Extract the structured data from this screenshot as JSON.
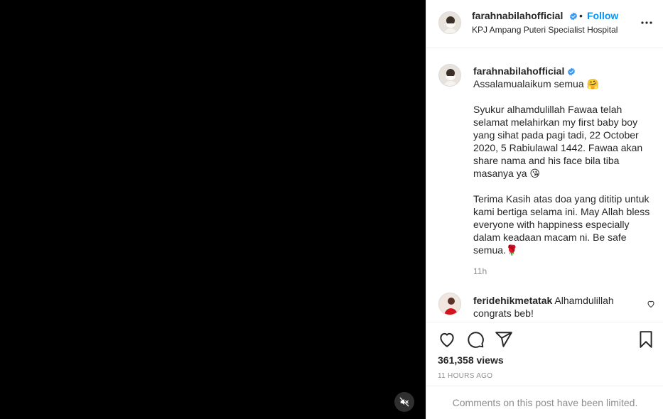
{
  "post": {
    "username": "farahnabilahofficial",
    "follow_label": "Follow",
    "separator": "•",
    "location": "KPJ Ampang Puteri Specialist Hospital",
    "caption": {
      "paragraphs": [
        "Assalamualaikum semua 🤗",
        "Syukur alhamdulillah Fawaa telah selamat melahirkan my first baby boy yang sihat pada pagi tadi, 22 October 2020, 5 Rabiulawal 1442. Fawaa akan share nama and his face bila tiba masanya ya 😘",
        "Terima Kasih atas doa yang dititip untuk kami bertiga selama ini. May Allah bless everyone with happiness especially dalam keadaan macam ni. Be safe semua.🌹"
      ],
      "time_ago": "11h"
    },
    "comment": {
      "username": "feridehikmetatak",
      "text": "Alhamdulillah congrats beb!"
    },
    "views_count": "361,358",
    "views_label": "views",
    "date": "11 HOURS AGO",
    "comments_limited": "Comments on this post have been limited."
  },
  "icons": {
    "verified": "verified-badge-icon",
    "more": "more-options-icon",
    "like": "heart-icon",
    "comment": "comment-icon",
    "share": "share-icon",
    "save": "bookmark-icon",
    "mute": "muted-speaker-icon"
  },
  "colors": {
    "accent": "#0095f6",
    "verified": "#3897f0",
    "muted_text": "#8e8e8e",
    "video_bg": "#000000"
  }
}
